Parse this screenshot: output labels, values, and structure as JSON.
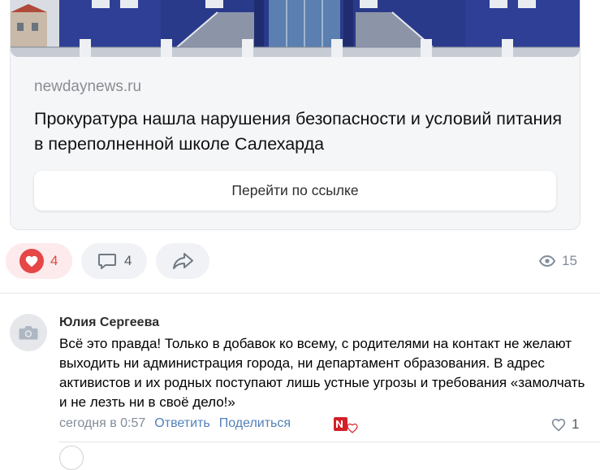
{
  "card": {
    "photo_alt": "building-photo",
    "domain": "newdaynews.ru",
    "headline": "Прокуратура нашла нарушения безопасности и условий питания в переполненной школе Салехарда",
    "link_button": "Перейти по ссылке"
  },
  "actions": {
    "likes": "4",
    "comments": "4",
    "views": "15",
    "like_color": "#e64646"
  },
  "comment": {
    "author": "Юлия Сергеева",
    "text": "Всё это правда! Только в добавок ко всему, с родителями на контакт не желают выходить ни администрация города, ни департамент образования. В адрес активистов и их родных поступают лишь устные угрозы и требования «замолчать и не лезть ни в своё дело!»",
    "timestamp": "сегодня в 0:57",
    "reply": "Ответить",
    "share": "Поделиться",
    "likes": "1"
  }
}
